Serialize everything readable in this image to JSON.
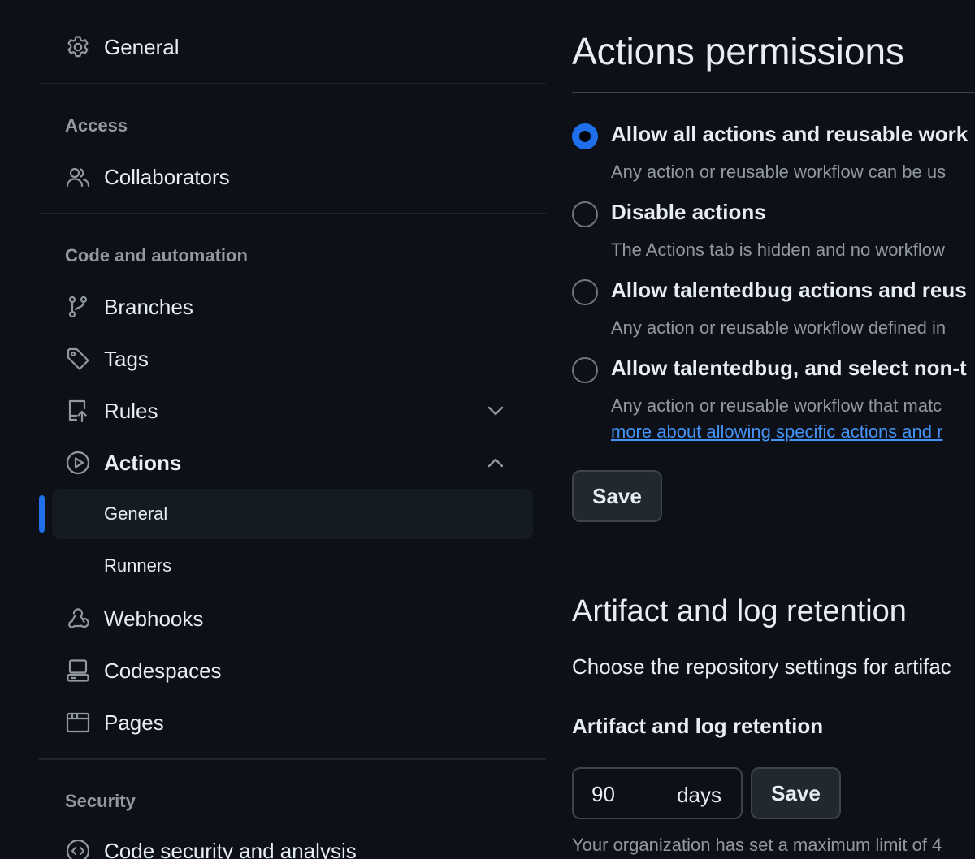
{
  "sidebar": {
    "top_item": {
      "label": "General",
      "icon": "gear-icon"
    },
    "sections": {
      "access": {
        "heading": "Access",
        "collaborators": {
          "label": "Collaborators",
          "icon": "people-icon"
        }
      },
      "code_automation": {
        "heading": "Code and automation",
        "branches": {
          "label": "Branches",
          "icon": "git-branch-icon"
        },
        "tags": {
          "label": "Tags",
          "icon": "tag-icon"
        },
        "rules": {
          "label": "Rules",
          "icon": "repo-push-icon",
          "expanded": false
        },
        "actions": {
          "label": "Actions",
          "icon": "play-icon",
          "expanded": true,
          "children": [
            {
              "label": "General",
              "active": true
            },
            {
              "label": "Runners",
              "active": false
            }
          ]
        },
        "webhooks": {
          "label": "Webhooks",
          "icon": "webhook-icon"
        },
        "codespaces": {
          "label": "Codespaces",
          "icon": "codespaces-icon"
        },
        "pages": {
          "label": "Pages",
          "icon": "browser-icon"
        }
      },
      "security": {
        "heading": "Security",
        "code_security": {
          "label": "Code security and analysis",
          "icon": "codescan-icon"
        }
      }
    }
  },
  "main": {
    "actions_permissions": {
      "title": "Actions permissions",
      "options": [
        {
          "label": "Allow all actions and reusable work",
          "description": "Any action or reusable workflow can be us",
          "checked": true
        },
        {
          "label": "Disable actions",
          "description": "The Actions tab is hidden and no workflow",
          "checked": false
        },
        {
          "label": "Allow talentedbug actions and reus",
          "description": "Any action or reusable workflow defined in",
          "checked": false
        },
        {
          "label": "Allow talentedbug, and select non-t",
          "description": "Any action or reusable workflow that matc",
          "link": "more about allowing specific actions and r",
          "checked": false
        }
      ],
      "save_label": "Save"
    },
    "artifact_retention": {
      "title": "Artifact and log retention",
      "description": "Choose the repository settings for artifac",
      "field_label": "Artifact and log retention",
      "value": "90",
      "suffix": "days",
      "save_label": "Save",
      "note": "Your organization has set a maximum limit of 4"
    }
  },
  "colors": {
    "background": "#0d1117",
    "accent": "#1f6feb",
    "link": "#4493f8",
    "muted_text": "#9198a1",
    "border": "#3d444d"
  }
}
